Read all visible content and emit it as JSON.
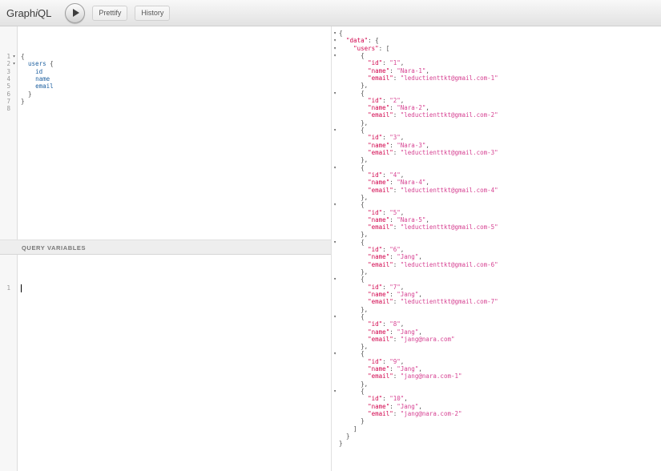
{
  "colors": {
    "key": "#D2054E",
    "string": "#D64292",
    "field": "#1F61A0",
    "punct": "#4a4a4a",
    "line_number": "#999999"
  },
  "topbar": {
    "logo_graph": "Graph",
    "logo_i": "i",
    "logo_ql": "QL",
    "execute_icon": "play-icon",
    "prettify_label": "Prettify",
    "history_label": "History"
  },
  "query_editor": {
    "lines": [
      {
        "number": "1",
        "fold": true,
        "tokens": [
          [
            "punct",
            "{"
          ]
        ]
      },
      {
        "number": "2",
        "fold": true,
        "tokens": [
          [
            "plain",
            "  "
          ],
          [
            "field",
            "users"
          ],
          [
            "punct",
            " {"
          ]
        ]
      },
      {
        "number": "3",
        "fold": false,
        "tokens": [
          [
            "plain",
            "    "
          ],
          [
            "field",
            "id"
          ]
        ]
      },
      {
        "number": "4",
        "fold": false,
        "tokens": [
          [
            "plain",
            "    "
          ],
          [
            "field",
            "name"
          ]
        ]
      },
      {
        "number": "5",
        "fold": false,
        "tokens": [
          [
            "plain",
            "    "
          ],
          [
            "field",
            "email"
          ]
        ]
      },
      {
        "number": "6",
        "fold": false,
        "tokens": [
          [
            "punct",
            "  }"
          ]
        ]
      },
      {
        "number": "7",
        "fold": false,
        "tokens": [
          [
            "punct",
            "}"
          ]
        ]
      },
      {
        "number": "8",
        "fold": false,
        "tokens": []
      }
    ]
  },
  "variables_panel": {
    "title": "QUERY VARIABLES",
    "line_number": "1",
    "cursor_visible": true
  },
  "result": {
    "root_key": "data",
    "collection_key": "users",
    "field_order": [
      "id",
      "name",
      "email"
    ],
    "users": [
      {
        "id": "1",
        "name": "Nara-1",
        "email": "leductienttkt@gmail.com-1"
      },
      {
        "id": "2",
        "name": "Nara-2",
        "email": "leductienttkt@gmail.com-2"
      },
      {
        "id": "3",
        "name": "Nara-3",
        "email": "leductienttkt@gmail.com-3"
      },
      {
        "id": "4",
        "name": "Nara-4",
        "email": "leductienttkt@gmail.com-4"
      },
      {
        "id": "5",
        "name": "Nara-5",
        "email": "leductienttkt@gmail.com-5"
      },
      {
        "id": "6",
        "name": "Jang",
        "email": "leductienttkt@gmail.com-6"
      },
      {
        "id": "7",
        "name": "Jang",
        "email": "leductienttkt@gmail.com-7"
      },
      {
        "id": "8",
        "name": "Jang",
        "email": "jang@nara.com"
      },
      {
        "id": "9",
        "name": "Jang",
        "email": "jang@nara.com-1"
      },
      {
        "id": "10",
        "name": "Jang",
        "email": "jang@nara.com-2"
      }
    ]
  }
}
